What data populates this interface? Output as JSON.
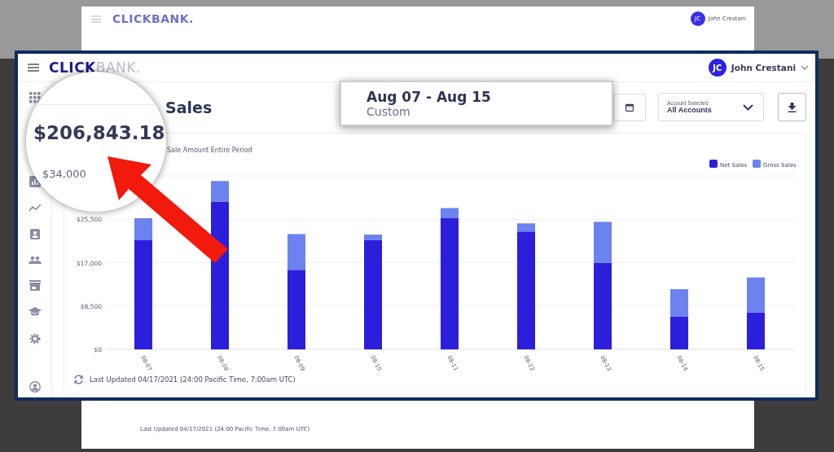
{
  "back_screen": {
    "logo": "CLICKBANK.",
    "avatar": "JC",
    "user_name": "John Crestani",
    "footer": "Last Updated 04/17/2021 (24:00 Pacific Time, 7:00am UTC)"
  },
  "header": {
    "logo_bold": "CLICK",
    "logo_light": "BANK.",
    "avatar": "JC",
    "user_name": "John Crestani"
  },
  "page": {
    "title": "Sales",
    "account_select": {
      "label": "Account Selected",
      "value": "All Accounts"
    }
  },
  "chart_card": {
    "subtitle": "Sale Amount Entire Period",
    "footer": "Last Updated 04/17/2021 (24:00 Pacific Time, 7:00am UTC)",
    "chart_data": {
      "type": "bar",
      "stacked": true,
      "categories": [
        "08-07",
        "08-08",
        "08-09",
        "08-10",
        "08-11",
        "08-12",
        "08-13",
        "08-14",
        "08-15"
      ],
      "ylim": [
        0,
        34000
      ],
      "grid": true,
      "legend": true,
      "yticks": [
        {
          "value": 0,
          "label": "$0"
        },
        {
          "value": 8500,
          "label": "$8,500"
        },
        {
          "value": 17000,
          "label": "$17,000"
        },
        {
          "value": 25500,
          "label": "$25,500"
        }
      ],
      "series": [
        {
          "name": "Net Sales",
          "color": "#2b1fdc",
          "values": [
            21500,
            28900,
            15600,
            21400,
            25700,
            23100,
            17000,
            6400,
            7200
          ]
        },
        {
          "name": "Gross Sales",
          "color": "#6b82ef",
          "values": [
            4200,
            4100,
            7000,
            1100,
            2000,
            1600,
            8000,
            5400,
            6900
          ]
        }
      ]
    }
  },
  "magnifier": {
    "value": "$206,843.18",
    "axis_label": "$34,000"
  },
  "date_callout": {
    "range": "Aug 07 - Aug 15",
    "preset": "Custom"
  }
}
